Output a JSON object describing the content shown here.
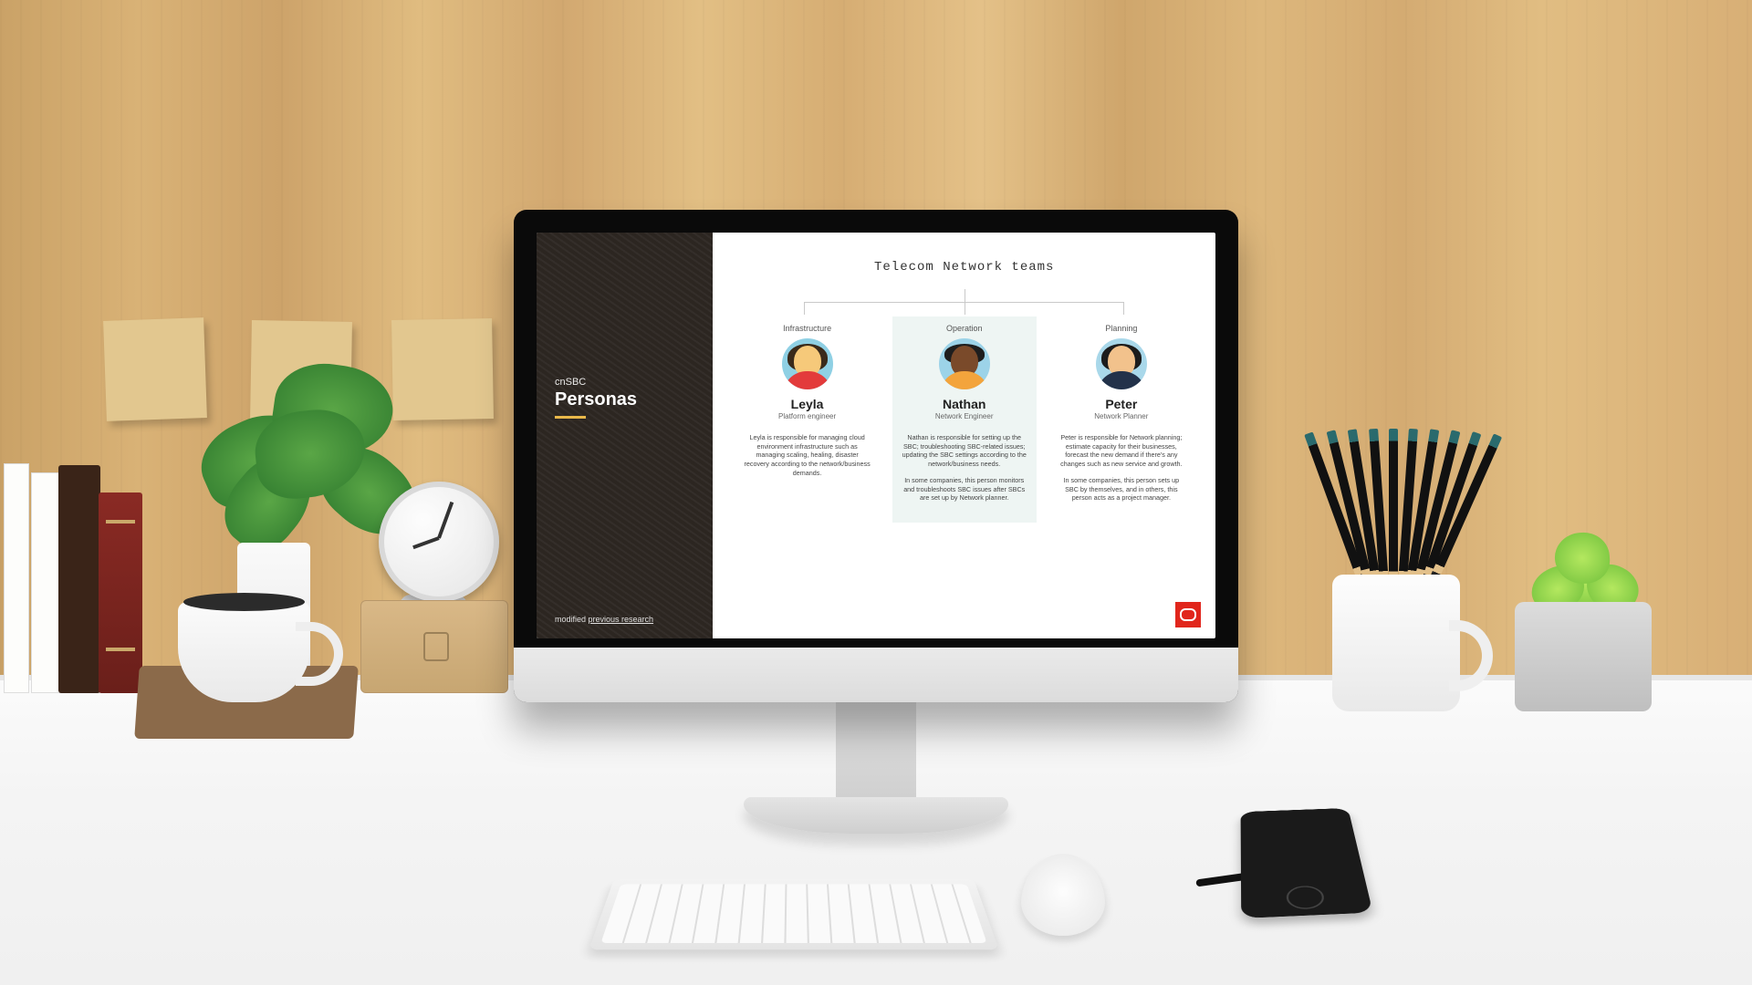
{
  "sidebar": {
    "subtitle": "cnSBC",
    "title": "Personas",
    "footer_prefix": "modified ",
    "footer_link": "previous research"
  },
  "main": {
    "title": "Telecom Network teams"
  },
  "personas": [
    {
      "category": "Infrastructure",
      "name": "Leyla",
      "role": "Platform engineer",
      "p1": "Leyla is responsible for managing cloud environment infrastructure such as managing scaling, healing, disaster recovery according to the network/business demands.",
      "p2": ""
    },
    {
      "category": "Operation",
      "name": "Nathan",
      "role": "Network Engineer",
      "p1": "Nathan is responsible for setting up the SBC; troubleshooting SBC-related issues; updating the SBC settings according to the network/business needs.",
      "p2": "In some companies, this person monitors and troubleshoots SBC issues after SBCs are set up by Network planner."
    },
    {
      "category": "Planning",
      "name": "Peter",
      "role": "Network Planner",
      "p1": "Peter is responsible for Network planning; estimate capacity for their businesses, forecast the new demand if there's any changes such as new service and growth.",
      "p2": "In some companies, this person sets up SBC by themselves, and in others, this person acts as a project manager."
    }
  ],
  "colors": {
    "accent_yellow": "#e9b84a",
    "brand_red": "#e1261c",
    "highlight_bg": "#eef5f3"
  }
}
